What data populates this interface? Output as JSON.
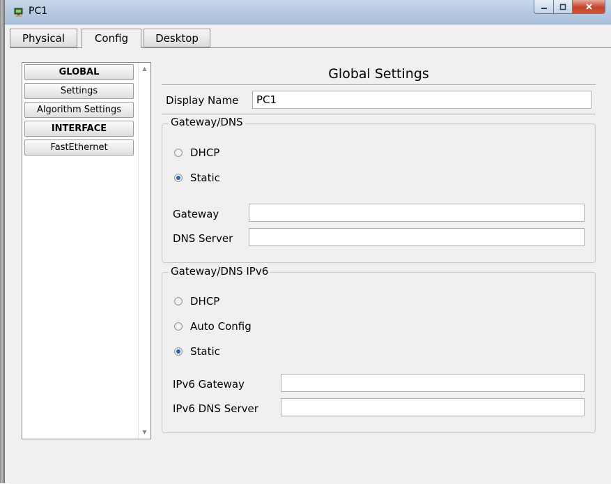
{
  "window": {
    "title": "PC1"
  },
  "tabs": [
    {
      "label": "Physical"
    },
    {
      "label": "Config"
    },
    {
      "label": "Desktop"
    }
  ],
  "nav": {
    "items": [
      {
        "label": "GLOBAL"
      },
      {
        "label": "Settings"
      },
      {
        "label": "Algorithm Settings"
      },
      {
        "label": "INTERFACE"
      },
      {
        "label": "FastEthernet"
      }
    ]
  },
  "main": {
    "title": "Global Settings",
    "display_name_label": "Display Name",
    "display_name_value": "PC1",
    "ipv4": {
      "legend": "Gateway/DNS",
      "dhcp_label": "DHCP",
      "static_label": "Static",
      "selected": "Static",
      "gateway_label": "Gateway",
      "gateway_value": "",
      "dns_label": "DNS Server",
      "dns_value": ""
    },
    "ipv6": {
      "legend": "Gateway/DNS IPv6",
      "dhcp_label": "DHCP",
      "auto_label": "Auto Config",
      "static_label": "Static",
      "selected": "Static",
      "gateway_label": "IPv6 Gateway",
      "gateway_value": "",
      "dns_label": "IPv6 DNS Server",
      "dns_value": ""
    }
  }
}
